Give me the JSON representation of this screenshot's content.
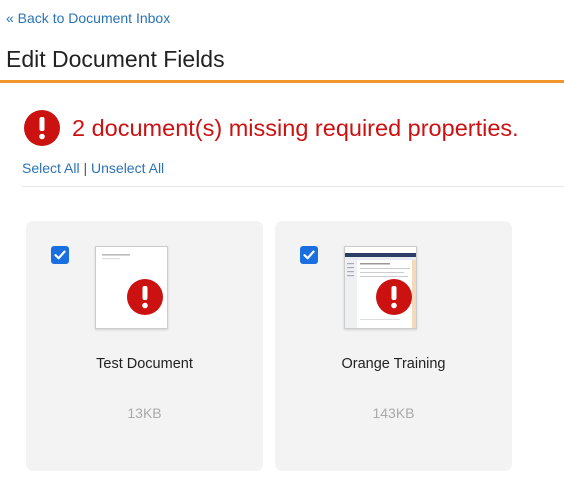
{
  "nav": {
    "back_label": "« Back to Document Inbox"
  },
  "page": {
    "title": "Edit Document Fields"
  },
  "alert": {
    "message": "2 document(s) missing required properties.",
    "color": "#cc1111"
  },
  "selection": {
    "select_all": "Select All",
    "separator": "|",
    "unselect_all": "Unselect All"
  },
  "documents": [
    {
      "name": "Test Document",
      "size": "13KB",
      "checked": true,
      "missing_properties": true,
      "thumbnail": "plain-text-page"
    },
    {
      "name": "Orange Training",
      "size": "143KB",
      "checked": true,
      "missing_properties": true,
      "thumbnail": "app-screenshot"
    }
  ],
  "colors": {
    "accent_rule": "#f0962b",
    "link": "#2a73b6",
    "checkbox": "#1a6fe0",
    "card_bg": "#f3f3f3"
  }
}
